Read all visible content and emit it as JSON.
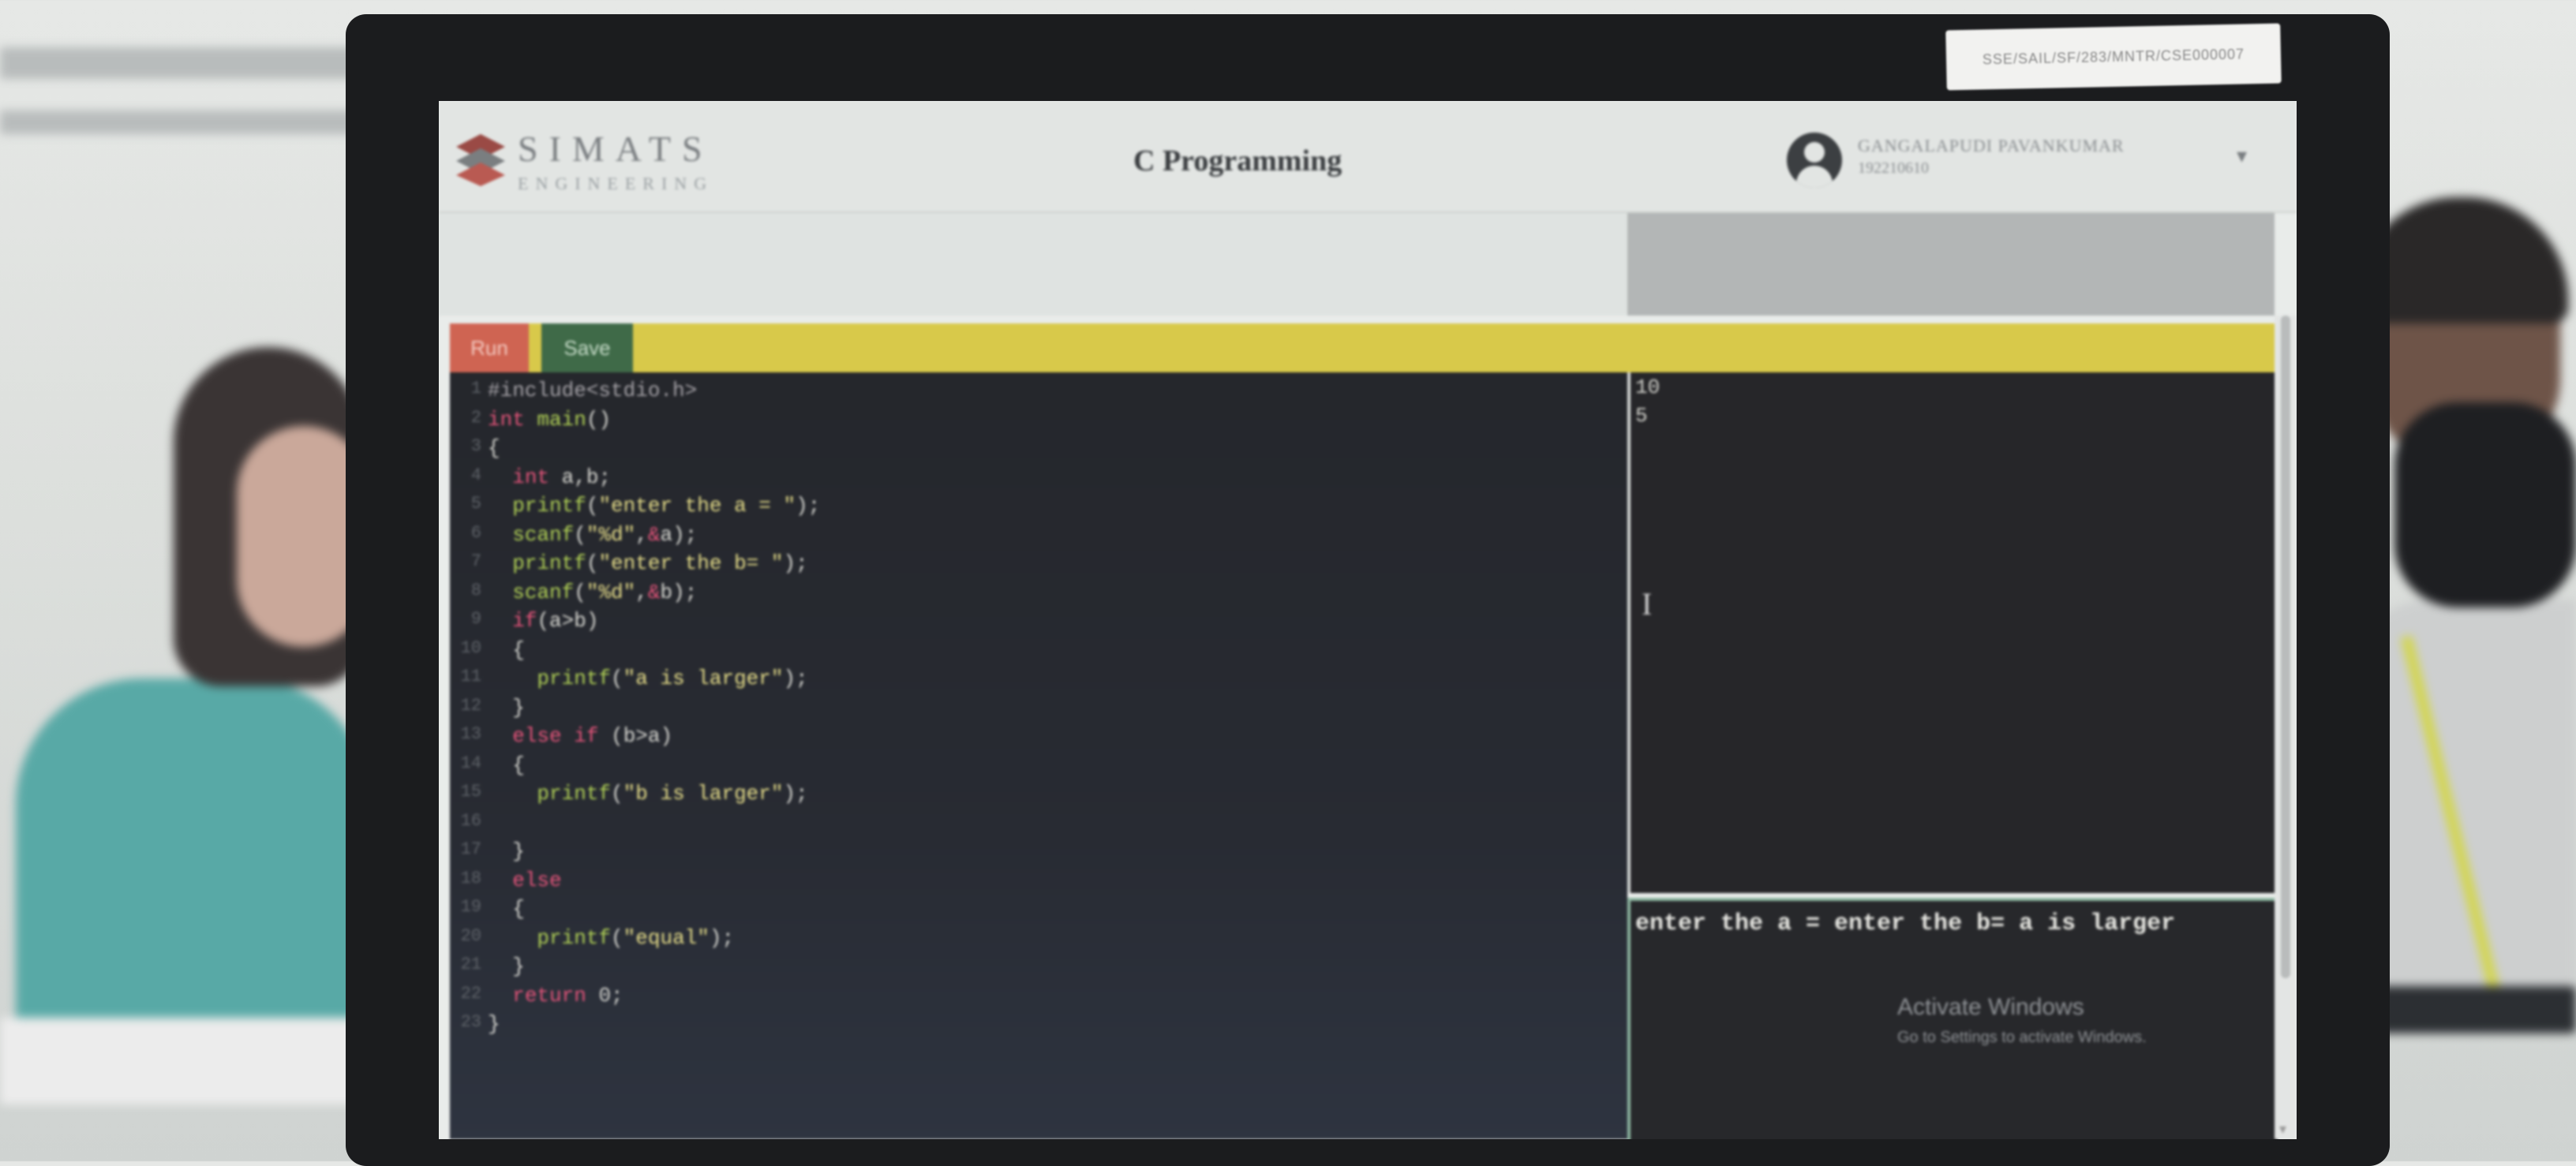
{
  "asset_label": "SSE/SAIL/SF/283/MNTR/CSE000007",
  "header": {
    "logo_title": "SIMATS",
    "logo_subtitle": "ENGINEERING",
    "page_title": "C Programming",
    "user_name": "GANGALAPUDI PAVANKUMAR",
    "user_id": "192210610"
  },
  "toolbar": {
    "run_label": "Run",
    "save_label": "Save"
  },
  "editor": {
    "lines": [
      {
        "n": "1",
        "code": "#include<stdio.h>"
      },
      {
        "n": "2",
        "code": "int main()"
      },
      {
        "n": "3",
        "code": "{"
      },
      {
        "n": "4",
        "code": "  int a,b;"
      },
      {
        "n": "5",
        "code": "  printf(\"enter the a = \");"
      },
      {
        "n": "6",
        "code": "  scanf(\"%d\",&a);"
      },
      {
        "n": "7",
        "code": "  printf(\"enter the b= \");"
      },
      {
        "n": "8",
        "code": "  scanf(\"%d\",&b);"
      },
      {
        "n": "9",
        "code": "  if(a>b)"
      },
      {
        "n": "10",
        "code": "  {"
      },
      {
        "n": "11",
        "code": "    printf(\"a is larger\");"
      },
      {
        "n": "12",
        "code": "  }"
      },
      {
        "n": "13",
        "code": "  else if (b>a)"
      },
      {
        "n": "14",
        "code": "  {"
      },
      {
        "n": "15",
        "code": "    printf(\"b is larger\");"
      },
      {
        "n": "16",
        "code": ""
      },
      {
        "n": "17",
        "code": "  }"
      },
      {
        "n": "18",
        "code": "  else"
      },
      {
        "n": "19",
        "code": "  {"
      },
      {
        "n": "20",
        "code": "    printf(\"equal\");"
      },
      {
        "n": "21",
        "code": "  }"
      },
      {
        "n": "22",
        "code": "  return 0;"
      },
      {
        "n": "23",
        "code": "}"
      }
    ]
  },
  "stdin": {
    "lines": [
      "10",
      "5"
    ]
  },
  "output": {
    "text": "enter the a = enter the b= a is larger"
  },
  "watermark": {
    "title": "Activate Windows",
    "subtitle": "Go to Settings to activate Windows."
  },
  "colors": {
    "toolbar": "#d8c94a",
    "run_button": "#cf6452",
    "save_button": "#3f6a48",
    "editor_bg": "#26282d",
    "keyword": "#e5547a",
    "function": "#b2d256",
    "string": "#e8df8a"
  }
}
